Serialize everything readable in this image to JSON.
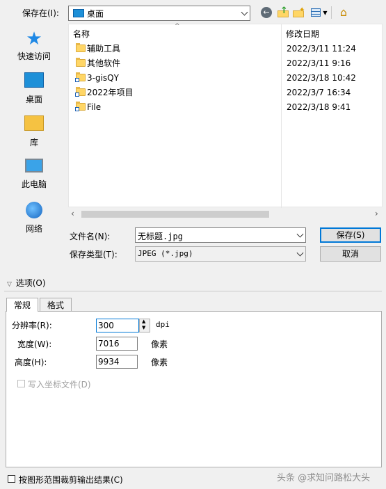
{
  "toolbar": {
    "save_in_label": "保存在(I):",
    "location_value": "桌面"
  },
  "places": [
    {
      "label": "快速访问",
      "icon": "star-icon"
    },
    {
      "label": "桌面",
      "icon": "desktop-icon"
    },
    {
      "label": "库",
      "icon": "library-icon"
    },
    {
      "label": "此电脑",
      "icon": "computer-icon"
    },
    {
      "label": "网络",
      "icon": "network-icon"
    }
  ],
  "file_list": {
    "columns": [
      "名称",
      "修改日期"
    ],
    "rows": [
      {
        "name": "辅助工具",
        "date": "2022/3/11 11:24",
        "shortcut": false
      },
      {
        "name": "其他软件",
        "date": "2022/3/11 9:16",
        "shortcut": false
      },
      {
        "name": "3-gisQY",
        "date": "2022/3/18 10:42",
        "shortcut": true
      },
      {
        "name": "2022年项目",
        "date": "2022/3/7 16:34",
        "shortcut": true
      },
      {
        "name": "File",
        "date": "2022/3/18 9:41",
        "shortcut": true
      }
    ]
  },
  "form": {
    "filename_label": "文件名(N):",
    "filename_value": "无标题.jpg",
    "filetype_label": "保存类型(T):",
    "filetype_value": "JPEG (*.jpg)",
    "save_button": "保存(S)",
    "cancel_button": "取消"
  },
  "options": {
    "toggle_label": "选项(O)",
    "tabs": [
      "常规",
      "格式"
    ],
    "resolution_label": "分辨率(R):",
    "resolution_value": "300",
    "resolution_unit": "dpi",
    "width_label": "宽度(W):",
    "width_value": "7016",
    "width_unit": "像素",
    "height_label": "高度(H):",
    "height_value": "9934",
    "height_unit": "像素",
    "world_file_label": "写入坐标文件(D)"
  },
  "footer": {
    "clip_label": "按图形范围裁剪输出结果(C)",
    "watermark": "头条 @求知问路松大头"
  },
  "colors": {
    "accent": "#0078d7",
    "folder": "#ffd666"
  }
}
